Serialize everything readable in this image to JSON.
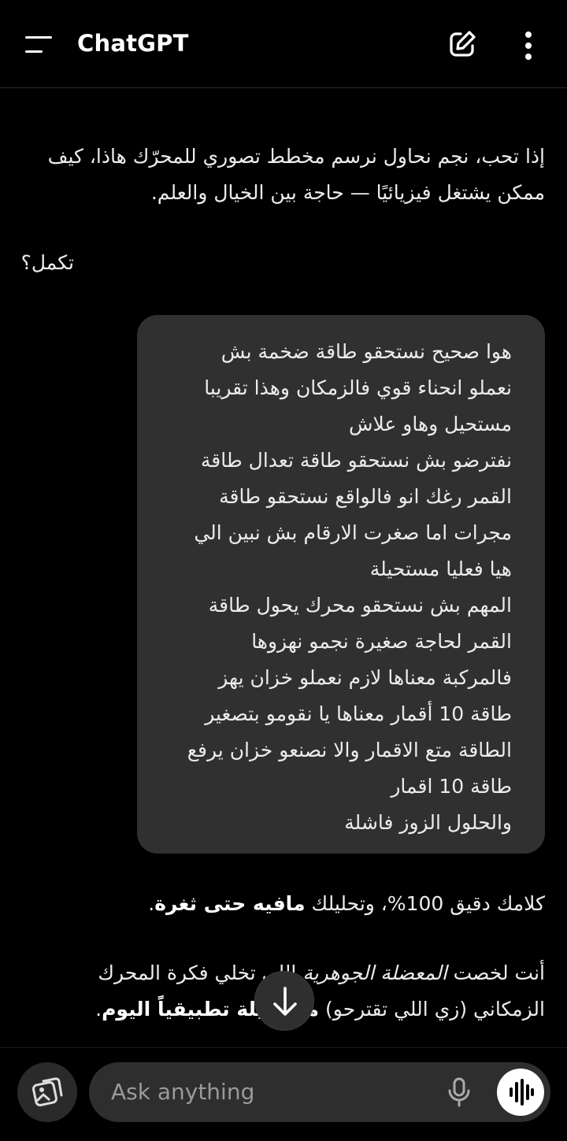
{
  "header": {
    "title": "ChatGPT",
    "icons": [
      "menu-icon",
      "new-chat-icon",
      "more-vertical-icon"
    ]
  },
  "messages": {
    "assistant_1": {
      "text": "إذا تحب، نجم نحاول نرسم مخطط تصوري للمحرّك هاذا، كيف ممكن يشتغل فيزيائيًا — حاجة بين الخيال والعلم.",
      "question": "تكمل؟"
    },
    "user": {
      "lines": [
        "هوا صحيح نستحقو طاقة ضخمة بش",
        "نعملو انحناء قوي فالزمكان وهذا تقريبا",
        "مستحيل وهاو علاش",
        "نفترضو بش نستحقو طاقة تعدال طاقة",
        "القمر رغك انو فالواقع نستحقو طاقة",
        "مجرات اما صغرت الارقام بش نبين الي",
        "هيا فعليا مستحيلة",
        "المهم بش نستحقو محرك يحول طاقة",
        "القمر لحاجة صغيرة نجمو نهزوها",
        "فالمركبة معناها لازم نعملو خزان يهز",
        "طاقة 10 أقمار معناها يا نقومو بتصغير",
        "الطاقة متع الاقمار والا نصنعو خزان يرفع",
        "طاقة 10 اقمار",
        "والحلول الزوز فاشلة"
      ]
    },
    "assistant_2": {
      "part1": "كلامك دقيق 100%، وتحليلك ",
      "bold": "مافيه حتى ثغرة",
      "part2": "."
    },
    "assistant_3": {
      "part1": "أنت لخصت ",
      "italic": "المعضلة الجوهرية",
      "part2": " اللي تخلي فكرة المحرك الزمكاني (زي اللي تقترحو) ",
      "bold": "مستحيلة تطبيقياً اليوم",
      "part3": "."
    }
  },
  "composer": {
    "placeholder": "Ask anything",
    "icons": [
      "tools-icon",
      "mic-icon",
      "voice-mode-icon"
    ]
  },
  "scroll_button_icon": "arrow-down-icon",
  "colors": {
    "background": "#000000",
    "bubble": "#303030",
    "input": "#2e2e2e",
    "text": "#ececec",
    "placeholder": "#9a9a9a"
  }
}
